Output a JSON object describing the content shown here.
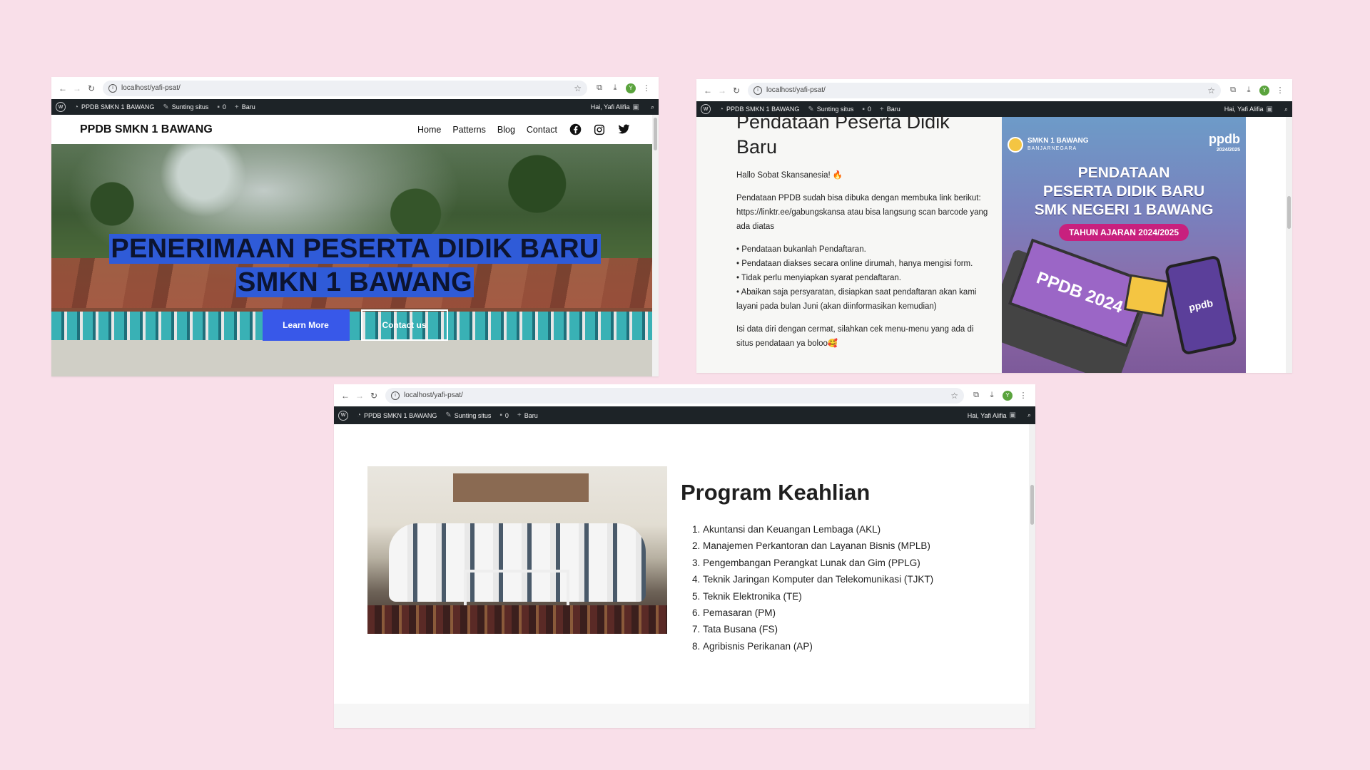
{
  "browser": {
    "url": "localhost/yafi-psat/",
    "avatar_letter": "Y"
  },
  "adminbar": {
    "site_name": "PPDB SMKN 1 BAWANG",
    "edit_site": "Sunting situs",
    "comments_count": "0",
    "new_label": "Baru",
    "greeting": "Hai, Yafi Alifia"
  },
  "home": {
    "brand": "PPDB SMKN 1 BAWANG",
    "nav": [
      "Home",
      "Patterns",
      "Blog",
      "Contact"
    ],
    "social_icons": [
      "facebook-icon",
      "instagram-icon",
      "twitter-icon"
    ],
    "hero_line1": "PENERIMAAN PESERTA DIDIK BARU",
    "hero_line2": "SMKN 1 BAWANG",
    "btn_learn": "Learn More",
    "btn_contact": "Contact us",
    "accent": "#3858e9"
  },
  "post": {
    "title_line1": "Pendataan Peserta Didik",
    "title_line2": "Baru",
    "greeting": "Hallo Sobat Skansanesia! 🔥",
    "intro": "Pendataan PPDB sudah bisa dibuka dengan membuka link berikut: https://linktr.ee/gabungskansa atau bisa langsung scan barcode yang ada diatas",
    "bullets": [
      "• Pendataan bukanlah Pendaftaran.",
      "• Pendataan diakses secara online dirumah, hanya mengisi form.",
      "• Tidak perlu menyiapkan syarat pendaftaran.",
      "• Abaikan saja persyaratan, disiapkan saat pendaftaran akan kami layani pada bulan Juni (akan diinformasikan kemudian)"
    ],
    "outro": "Isi data diri dengan cermat, silahkan cek menu-menu yang ada di situs pendataan ya boloo🥰"
  },
  "poster": {
    "school": "SMKN 1 BAWANG",
    "region": "BANJARNEGARA",
    "ppdb": "ppdb",
    "ppdb_year": "2024/2025",
    "title_lines": [
      "PENDATAAN",
      "PESERTA DIDIK BARU",
      "SMK NEGERI 1 BAWANG"
    ],
    "year_badge": "TAHUN AJARAN 2024/2025",
    "laptop_text": "PPDB 2024",
    "phone_text": "ppdb"
  },
  "program": {
    "title": "Program Keahlian",
    "items": [
      "Akuntansi dan Keuangan Lembaga (AKL)",
      "Manajemen Perkantoran dan Layanan Bisnis (MPLB)",
      "Pengembangan Perangkat Lunak dan Gim (PPLG)",
      "Teknik Jaringan Komputer dan Telekomunikasi (TJKT)",
      "Teknik Elektronika (TE)",
      "Pemasaran (PM)",
      "Tata Busana (FS)",
      "Agribisnis Perikanan (AP)"
    ]
  }
}
